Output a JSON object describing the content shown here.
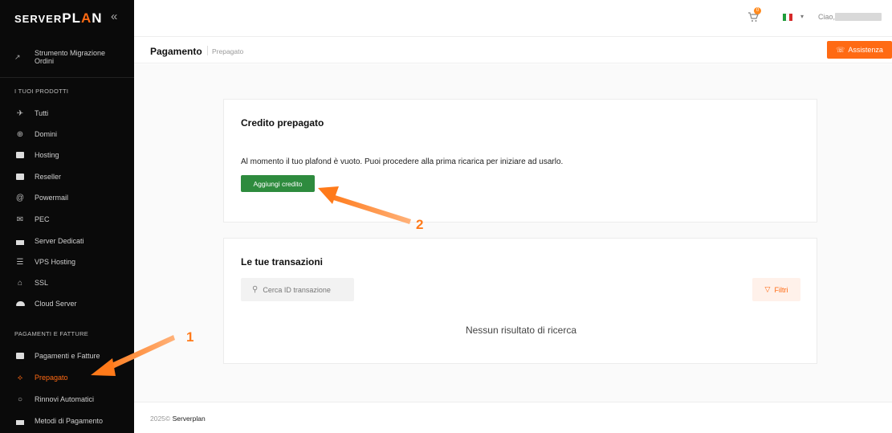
{
  "sidebar": {
    "logo": {
      "part1": "SERVER",
      "part2": "PL",
      "part3": "A",
      "part4": "N"
    },
    "collapse_glyph": "«",
    "migration": {
      "line1": "Strumento Migrazione",
      "line2": "Ordini"
    },
    "section_products": "I TUOI PRODOTTI",
    "products": [
      {
        "label": "Tutti",
        "icon": "rocket-icon"
      },
      {
        "label": "Domini",
        "icon": "globe-icon"
      },
      {
        "label": "Hosting",
        "icon": "server-icon"
      },
      {
        "label": "Reseller",
        "icon": "server-icon"
      },
      {
        "label": "Powermail",
        "icon": "at-icon"
      },
      {
        "label": "PEC",
        "icon": "mail-icon"
      },
      {
        "label": "Server Dedicati",
        "icon": "dedicated-icon"
      },
      {
        "label": "VPS Hosting",
        "icon": "vps-icon"
      },
      {
        "label": "SSL",
        "icon": "lock-icon"
      },
      {
        "label": "Cloud Server",
        "icon": "cloud-icon"
      }
    ],
    "section_payments": "PAGAMENTI E FATTURE",
    "payments": [
      {
        "label": "Pagamenti e Fatture",
        "icon": "wallet-icon"
      },
      {
        "label": "Prepagato",
        "icon": "prepaid-icon",
        "active": true
      },
      {
        "label": "Rinnovi Automatici",
        "icon": "renew-icon"
      },
      {
        "label": "Metodi di Pagamento",
        "icon": "card-icon"
      }
    ]
  },
  "topbar": {
    "cart_count": "0",
    "language": "IT",
    "greeting": "Ciao,"
  },
  "header": {
    "title": "Pagamento",
    "subtitle": "Prepagato",
    "assist_label": "Assistenza"
  },
  "credit": {
    "title": "Credito prepagato",
    "message": "Al momento il tuo plafond è vuoto. Puoi procedere alla prima ricarica per iniziare ad usarlo.",
    "button": "Aggiungi credito"
  },
  "transactions": {
    "title": "Le tue transazioni",
    "search_placeholder": "Cerca ID transazione",
    "filter_label": "Filtri",
    "empty": "Nessun risultato di ricerca"
  },
  "footer": {
    "year": "2025©",
    "brand": "Serverplan"
  },
  "annotations": {
    "step1": "1",
    "step2": "2"
  },
  "colors": {
    "accent": "#ff6a13",
    "green": "#2e8b3e",
    "sidebar": "#0a0a0a"
  }
}
